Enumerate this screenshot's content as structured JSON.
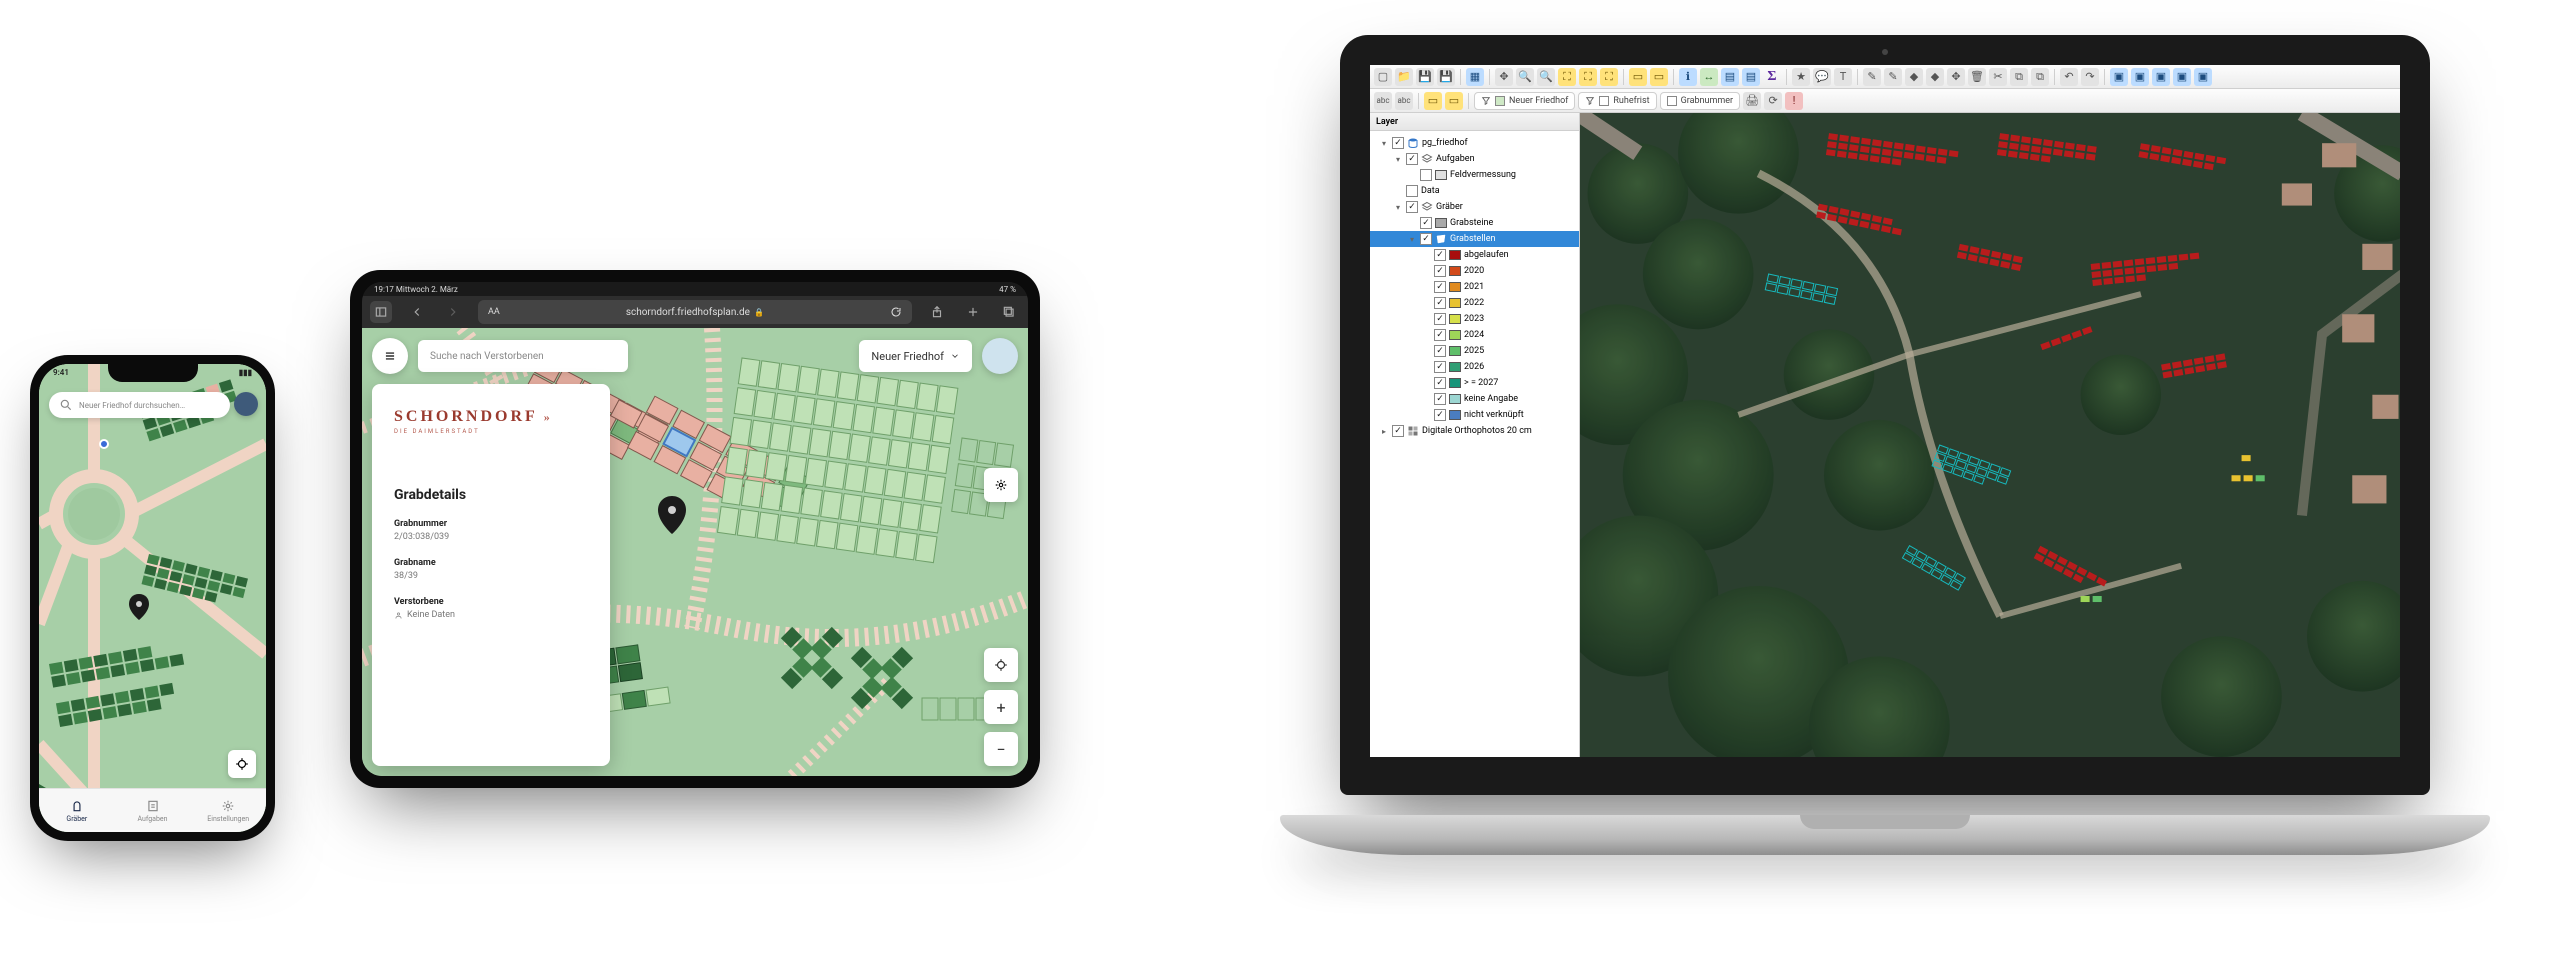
{
  "phone": {
    "status": {
      "time": "9:41"
    },
    "search_placeholder": "Neuer Friedhof durchsuchen…",
    "nav": {
      "items": [
        {
          "label": "Gräber",
          "active": true
        },
        {
          "label": "Aufgaben",
          "active": false
        },
        {
          "label": "Einstellungen",
          "active": false
        }
      ]
    }
  },
  "tablet": {
    "status": {
      "left": "19:17  Mittwoch 2. März",
      "right": "47 %"
    },
    "browser": {
      "text_size": "AA",
      "url": "schorndorf.friedhofsplan.de",
      "lock": "🔒"
    },
    "search_placeholder": "Suche nach Verstorbenen",
    "dropdown_label": "Neuer Friedhof",
    "brand": {
      "name": "SCHORNDORF",
      "sub": "DIE DAIMLERSTADT"
    },
    "details": {
      "title": "Grabdetails",
      "fields": [
        {
          "label": "Grabnummer",
          "value": "2/03:038/039"
        },
        {
          "label": "Grabname",
          "value": "38/39"
        },
        {
          "label": "Verstorbene",
          "value": "Keine Daten"
        }
      ]
    }
  },
  "laptop": {
    "toolbar_row2_chips": [
      {
        "label": "Neuer Friedhof",
        "color": "#cfe9c6"
      },
      {
        "label": "Ruhefrist",
        "color": "#ffffff"
      },
      {
        "label": "Grabnummer",
        "color": "#ffffff"
      }
    ],
    "layer_panel": {
      "title": "Layer",
      "tree": [
        {
          "depth": 0,
          "expander": "▾",
          "check": true,
          "icon": "pg",
          "label": "pg_friedhof"
        },
        {
          "depth": 1,
          "expander": "▾",
          "check": true,
          "icon": "group",
          "label": "Aufgaben"
        },
        {
          "depth": 2,
          "expander": "",
          "check": false,
          "icon": "color",
          "color": "#e0e0e0",
          "label": "Feldvermessung"
        },
        {
          "depth": 1,
          "expander": "",
          "check": false,
          "icon": null,
          "label": "Data"
        },
        {
          "depth": 1,
          "expander": "▾",
          "check": true,
          "icon": "group",
          "label": "Gräber"
        },
        {
          "depth": 2,
          "expander": "",
          "check": true,
          "icon": "color",
          "color": "#a9a9a9",
          "label": "Grabsteine"
        },
        {
          "depth": 2,
          "expander": "▾",
          "check": true,
          "icon": "poly",
          "label": "Grabstellen",
          "selected": true
        },
        {
          "depth": 3,
          "expander": "",
          "check": true,
          "icon": "color",
          "color": "#a70d0d",
          "label": "abgelaufen"
        },
        {
          "depth": 3,
          "expander": "",
          "check": true,
          "icon": "color",
          "color": "#d24a1a",
          "label": "2020"
        },
        {
          "depth": 3,
          "expander": "",
          "check": true,
          "icon": "color",
          "color": "#e08a1e",
          "label": "2021"
        },
        {
          "depth": 3,
          "expander": "",
          "check": true,
          "icon": "color",
          "color": "#e8c230",
          "label": "2022"
        },
        {
          "depth": 3,
          "expander": "",
          "check": true,
          "icon": "color",
          "color": "#d6e04a",
          "label": "2023"
        },
        {
          "depth": 3,
          "expander": "",
          "check": true,
          "icon": "color",
          "color": "#9ed658",
          "label": "2024"
        },
        {
          "depth": 3,
          "expander": "",
          "check": true,
          "icon": "color",
          "color": "#5fbf6a",
          "label": "2025"
        },
        {
          "depth": 3,
          "expander": "",
          "check": true,
          "icon": "color",
          "color": "#2f9e74",
          "label": "2026"
        },
        {
          "depth": 3,
          "expander": "",
          "check": true,
          "icon": "color",
          "color": "#17957a",
          "label": "> = 2027"
        },
        {
          "depth": 3,
          "expander": "",
          "check": true,
          "icon": "color",
          "color": "#9cd6d2",
          "label": "keine Angabe"
        },
        {
          "depth": 3,
          "expander": "",
          "check": true,
          "icon": "color",
          "color": "#4a7dbf",
          "label": "nicht verknüpft"
        },
        {
          "depth": 0,
          "expander": "▸",
          "check": true,
          "icon": "raster",
          "label": "Digitale Orthophotos 20 cm"
        }
      ]
    }
  }
}
